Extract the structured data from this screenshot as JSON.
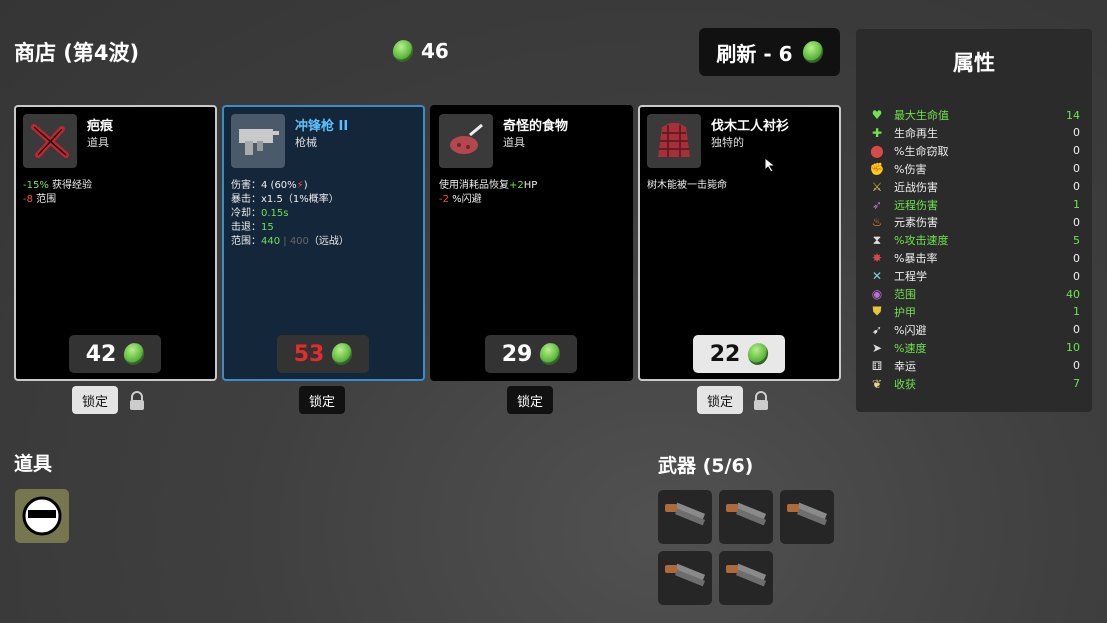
{
  "header": {
    "title": "商店 (第4波)",
    "gold": "46",
    "refresh_label": "刷新 - 6"
  },
  "cards": [
    {
      "name": "疤痕",
      "type": "道具",
      "lines": [
        {
          "parts": [
            {
              "t": "-15%",
              "c": "g"
            },
            {
              "t": " 获得经验",
              "c": ""
            }
          ]
        },
        {
          "parts": [
            {
              "t": "-8",
              "c": "r"
            },
            {
              "t": " 范围",
              "c": ""
            }
          ]
        }
      ],
      "price": "42",
      "lock_label": "锁定",
      "icon": "scar-icon"
    },
    {
      "name": "冲锋枪 II",
      "type": "枪械",
      "lines": [
        {
          "parts": [
            {
              "t": "伤害：",
              "c": ""
            },
            {
              "t": "4 (60%",
              "c": ""
            },
            {
              "t": "⚡",
              "c": "r"
            },
            {
              "t": ")",
              "c": ""
            }
          ]
        },
        {
          "parts": [
            {
              "t": "暴击：",
              "c": ""
            },
            {
              "t": "x1.5",
              "c": ""
            },
            {
              "t": "（1%概率）",
              "c": ""
            }
          ]
        },
        {
          "parts": [
            {
              "t": "冷却：",
              "c": ""
            },
            {
              "t": "0.15s",
              "c": "g"
            }
          ]
        },
        {
          "parts": [
            {
              "t": "击退：",
              "c": ""
            },
            {
              "t": "15",
              "c": "g"
            }
          ]
        },
        {
          "parts": [
            {
              "t": "范围：",
              "c": ""
            },
            {
              "t": "440",
              "c": "g"
            },
            {
              "t": " | 400",
              "c": "dim"
            },
            {
              "t": "（远战）",
              "c": ""
            }
          ]
        }
      ],
      "price": "53",
      "lock_label": "锁定",
      "icon": "smg-icon"
    },
    {
      "name": "奇怪的食物",
      "type": "道具",
      "lines": [
        {
          "parts": [
            {
              "t": "使用消耗品恢复",
              "c": ""
            },
            {
              "t": "+2",
              "c": "g"
            },
            {
              "t": "HP",
              "c": ""
            }
          ]
        },
        {
          "parts": [
            {
              "t": "-2",
              "c": "r"
            },
            {
              "t": " %闪避",
              "c": ""
            }
          ]
        }
      ],
      "price": "29",
      "lock_label": "锁定",
      "icon": "food-icon"
    },
    {
      "name": "伐木工人衬衫",
      "type": "独特的",
      "lines": [
        {
          "parts": [
            {
              "t": "树木能被一击毙命",
              "c": ""
            }
          ]
        }
      ],
      "price": "22",
      "lock_label": "锁定",
      "icon": "shirt-icon"
    }
  ],
  "items_section": {
    "label": "道具"
  },
  "weapons_section": {
    "label": "武器 (5/6)"
  },
  "stats": {
    "title": "属性",
    "rows": [
      {
        "name": "最大生命值",
        "value": "14",
        "green": true,
        "icon": "heart-icon",
        "glyph": "♥",
        "color": "#6ee34e"
      },
      {
        "name": "生命再生",
        "value": "0",
        "green": false,
        "icon": "regen-icon",
        "glyph": "✚",
        "color": "#6ee34e"
      },
      {
        "name": "%生命窃取",
        "value": "0",
        "green": false,
        "icon": "lifesteal-icon",
        "glyph": "⬤",
        "color": "#d84a4a"
      },
      {
        "name": "%伤害",
        "value": "0",
        "green": false,
        "icon": "damage-icon",
        "glyph": "✊",
        "color": "#d84a4a"
      },
      {
        "name": "近战伤害",
        "value": "0",
        "green": false,
        "icon": "melee-icon",
        "glyph": "⚔",
        "color": "#d8c04a"
      },
      {
        "name": "远程伤害",
        "value": "1",
        "green": true,
        "icon": "ranged-icon",
        "glyph": "➶",
        "color": "#c06ad8"
      },
      {
        "name": "元素伤害",
        "value": "0",
        "green": false,
        "icon": "elemental-icon",
        "glyph": "♨",
        "color": "#e88a3a"
      },
      {
        "name": "%攻击速度",
        "value": "5",
        "green": true,
        "icon": "attack-speed-icon",
        "glyph": "⧗",
        "color": "#dddddd"
      },
      {
        "name": "%暴击率",
        "value": "0",
        "green": false,
        "icon": "crit-icon",
        "glyph": "✸",
        "color": "#d84a4a"
      },
      {
        "name": "工程学",
        "value": "0",
        "green": false,
        "icon": "engineering-icon",
        "glyph": "✕",
        "color": "#7ad0e8"
      },
      {
        "name": "范围",
        "value": "40",
        "green": true,
        "icon": "range-icon",
        "glyph": "◉",
        "color": "#c06ad8"
      },
      {
        "name": "护甲",
        "value": "1",
        "green": true,
        "icon": "armor-icon",
        "glyph": "⛊",
        "color": "#e8c43a"
      },
      {
        "name": "%闪避",
        "value": "0",
        "green": false,
        "icon": "dodge-icon",
        "glyph": "➹",
        "color": "#dddddd"
      },
      {
        "name": "%速度",
        "value": "10",
        "green": true,
        "icon": "speed-icon",
        "glyph": "➤",
        "color": "#dddddd"
      },
      {
        "name": "幸运",
        "value": "0",
        "green": false,
        "icon": "luck-icon",
        "glyph": "⚅",
        "color": "#dddddd"
      },
      {
        "name": "收获",
        "value": "7",
        "green": true,
        "icon": "harvest-icon",
        "glyph": "❦",
        "color": "#e8d08a"
      }
    ]
  }
}
